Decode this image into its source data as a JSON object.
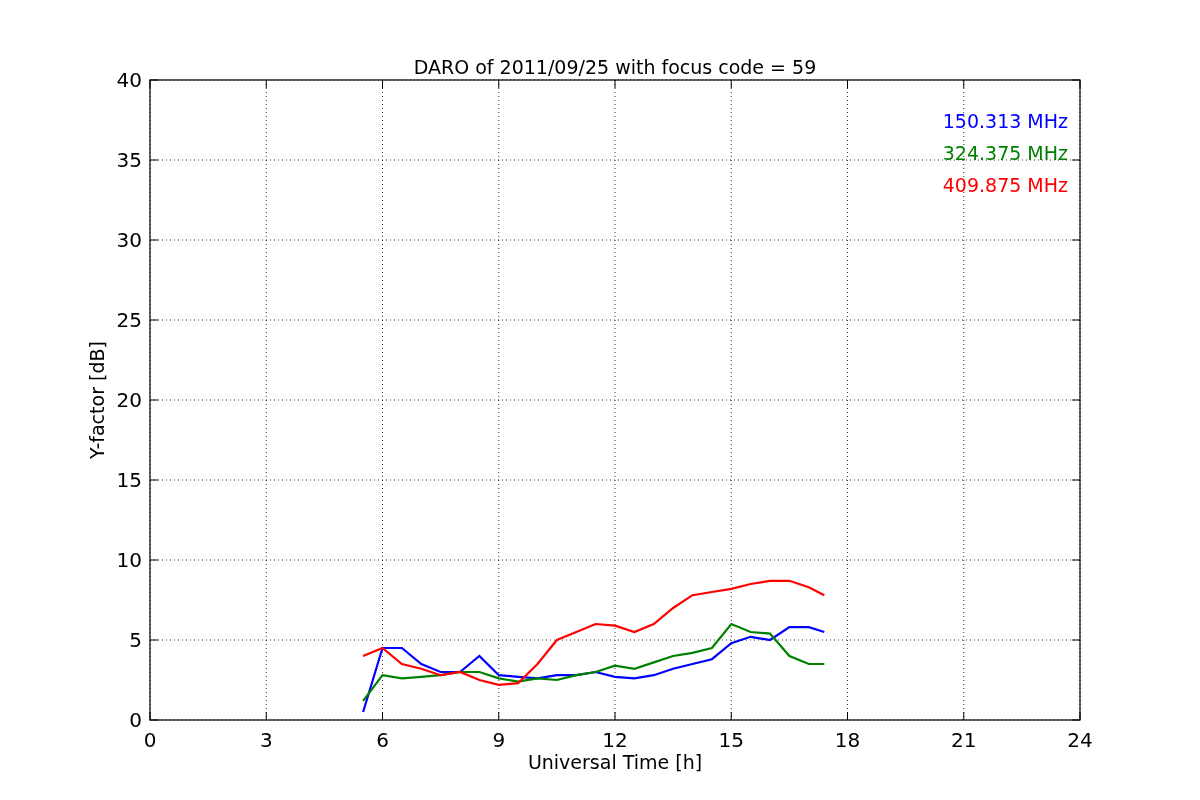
{
  "chart_data": {
    "type": "line",
    "title": "DARO of 2011/09/25 with focus code = 59",
    "xlabel": "Universal Time [h]",
    "ylabel": "Y-factor [dB]",
    "x": [
      5.5,
      6,
      6.5,
      7,
      7.5,
      8,
      8.5,
      9,
      9.5,
      10,
      10.5,
      11,
      11.5,
      12,
      12.5,
      13,
      13.5,
      14,
      14.5,
      15,
      15.5,
      16,
      16.5,
      17,
      17.4
    ],
    "series": [
      {
        "name": "150.313 MHz",
        "color": "#0000ff",
        "values": [
          0.5,
          4.5,
          4.5,
          3.5,
          3,
          3,
          4,
          2.8,
          2.7,
          2.6,
          2.8,
          2.8,
          3,
          2.7,
          2.6,
          2.8,
          3.2,
          3.5,
          3.8,
          4.8,
          5.2,
          5,
          5.8,
          5.8,
          5.5
        ]
      },
      {
        "name": "324.375 MHz",
        "color": "#008000",
        "values": [
          1.2,
          2.8,
          2.6,
          2.7,
          2.8,
          3,
          3,
          2.6,
          2.4,
          2.6,
          2.5,
          2.8,
          3,
          3.4,
          3.2,
          3.6,
          4,
          4.2,
          4.5,
          6,
          5.5,
          5.4,
          4,
          3.5,
          3.5
        ]
      },
      {
        "name": "409.875 MHz",
        "color": "#ff0000",
        "values": [
          4,
          4.5,
          3.5,
          3.2,
          2.8,
          3,
          2.5,
          2.2,
          2.3,
          3.5,
          5,
          5.5,
          6,
          5.9,
          5.5,
          6,
          7,
          7.8,
          8,
          8.2,
          8.5,
          8.7,
          8.7,
          8.3,
          7.8
        ]
      }
    ],
    "xlim": [
      0,
      24
    ],
    "ylim": [
      0,
      40
    ],
    "xticks": [
      0,
      3,
      6,
      9,
      12,
      15,
      18,
      21,
      24
    ],
    "yticks": [
      0,
      5,
      10,
      15,
      20,
      25,
      30,
      35,
      40
    ],
    "grid": true
  }
}
